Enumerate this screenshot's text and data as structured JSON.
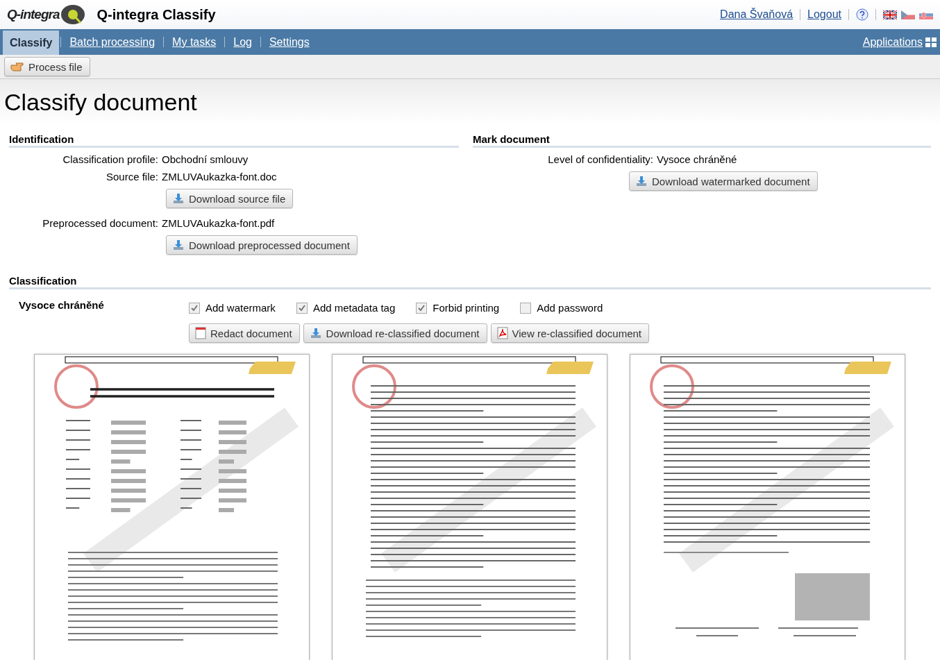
{
  "app": {
    "logo": "Q-integra",
    "title": "Q-integra Classify"
  },
  "user_links": [
    {
      "label": "Dana Švaňová"
    },
    {
      "label": "Logout"
    }
  ],
  "flags": [
    {
      "kind": "uk",
      "selected": true
    },
    {
      "kind": "cz",
      "selected": false
    },
    {
      "kind": "sk",
      "selected": false
    }
  ],
  "nav": {
    "tabs": [
      {
        "label": "Classify",
        "selected": true
      },
      {
        "label": "Batch processing",
        "selected": false
      },
      {
        "label": "My tasks",
        "selected": false
      },
      {
        "label": "Log",
        "selected": false
      },
      {
        "label": "Settings",
        "selected": false
      }
    ],
    "applications": "Applications"
  },
  "toolbar": {
    "button": "Process file"
  },
  "page_title": "Classify document",
  "identification": {
    "heading": "Identification",
    "rows": [
      {
        "label": "Classification profile:",
        "value": "Obchodní smlouvy"
      },
      {
        "label": "Source file:",
        "value": "ZMLUVAukazka-font.doc",
        "button": "Download source file"
      },
      {
        "label": "Preprocessed document:",
        "value": "ZMLUVAukazka-font.pdf",
        "button": "Download preprocessed document"
      }
    ]
  },
  "mark": {
    "heading": "Mark document",
    "label": "Level of confidentiality:",
    "value": "Vysoce chráněné",
    "button": "Download watermarked document"
  },
  "classification": {
    "heading": "Classification",
    "level": "Vysoce chráněné",
    "options": [
      {
        "label": "Add watermark",
        "checked": true
      },
      {
        "label": "Add metadata tag",
        "checked": true
      },
      {
        "label": "Forbid printing",
        "checked": true
      },
      {
        "label": "Add password",
        "checked": false
      }
    ],
    "buttons": [
      {
        "kind": "redact",
        "label": "Redact document"
      },
      {
        "kind": "download",
        "label": "Download re-classified document"
      },
      {
        "kind": "pdf",
        "label": "View re-classified document"
      }
    ]
  }
}
